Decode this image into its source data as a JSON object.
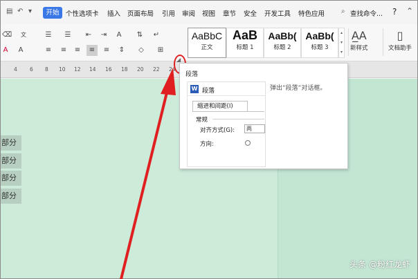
{
  "menu": {
    "tabs": [
      "开始",
      "个性选项卡",
      "插入",
      "页面布局",
      "引用",
      "审阅",
      "视图",
      "章节",
      "安全",
      "开发工具",
      "特色应用"
    ],
    "search_label": "查找命令...",
    "help": "?"
  },
  "styles": [
    {
      "sample": "AaBbC",
      "name": "正文"
    },
    {
      "sample": "AaB",
      "name": "标题 1"
    },
    {
      "sample": "AaBb(",
      "name": "标题 2"
    },
    {
      "sample": "AaBb(",
      "name": "标题 3"
    }
  ],
  "right_tools": {
    "new_style": "新样式",
    "writing_assistant": "文档助手"
  },
  "ruler": {
    "numbers": [
      "4",
      "6",
      "8",
      "10",
      "12",
      "14",
      "16",
      "18",
      "20",
      "22",
      "24"
    ]
  },
  "document": {
    "lines": [
      "部分",
      "部分",
      "部分",
      "部分"
    ]
  },
  "tooltip": {
    "title": "段落",
    "description": "弹出“段落”对话框。",
    "preview": {
      "window_title": "段落",
      "tab": "缩进和间距(I)",
      "section": "常规",
      "alignment_label": "对齐方式(G):",
      "alignment_value": "两",
      "direction_label": "方向:"
    }
  },
  "watermark": "头条 @粉红龙虾",
  "colors": {
    "accent": "#3b78e7",
    "highlight_red": "#e02020",
    "page_green": "#cdebd9"
  }
}
